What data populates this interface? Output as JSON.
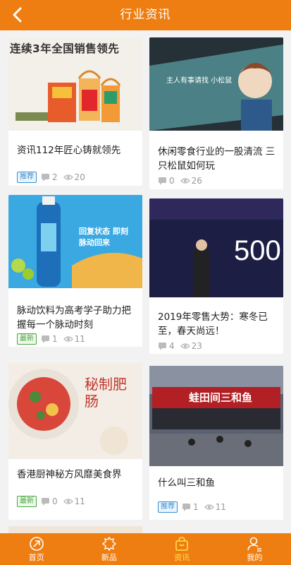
{
  "header": {
    "title": "行业资讯"
  },
  "articles": [
    {
      "thumb_text": "连续3年全国销售领先",
      "title": "资讯112年匠心铸就领先",
      "tag": "推荐",
      "comments": "2",
      "views": "20"
    },
    {
      "thumb_text": "主人有事请找 小松鼠",
      "title": "休闲零食行业的一股清流 三只松鼠如何玩",
      "tag": "",
      "comments": "0",
      "views": "26"
    },
    {
      "thumb_text": "回复状态 即刻脉动回来",
      "title": "脉动饮料为高考学子助力把握每一个脉动时刻",
      "tag": "最新",
      "comments": "1",
      "views": "11"
    },
    {
      "thumb_text": "500",
      "title": "2019年零售大势：寒冬已至，春天尚远！",
      "tag": "",
      "comments": "4",
      "views": "23"
    },
    {
      "thumb_text": "秘制肥肠",
      "title": "香港厨神秘方风靡美食界",
      "tag": "最新",
      "comments": "0",
      "views": "11"
    },
    {
      "thumb_text": "蛙田间三和鱼",
      "title": "什么叫三和鱼",
      "tag": "推荐",
      "comments": "1",
      "views": "11"
    }
  ],
  "tabbar": [
    {
      "label": "首页",
      "icon": "home-icon"
    },
    {
      "label": "新品",
      "icon": "new-product-icon"
    },
    {
      "label": "资讯",
      "icon": "news-bag-icon"
    },
    {
      "label": "我的",
      "icon": "profile-icon"
    }
  ],
  "colors": {
    "accent": "#ef7e12",
    "active_tab": "#ffe14a",
    "tag_recommend": "#3a8fd0",
    "tag_new": "#4aa640"
  }
}
